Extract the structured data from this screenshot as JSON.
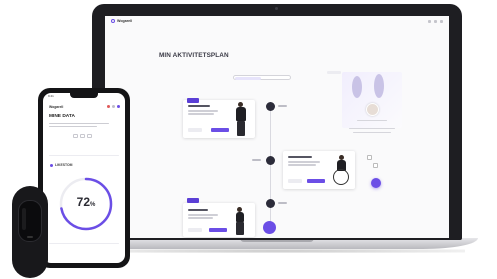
{
  "laptop": {
    "app_logo": "Wogarell",
    "screen_title": "MIN AKTIVITETSPLAN"
  },
  "phone": {
    "status_time": "9:41",
    "app_logo": "Wogarell",
    "title": "MINE DATA",
    "section_label": "LIKESTOM",
    "progress_value": 72,
    "progress_label": "72",
    "progress_unit": "%"
  },
  "colors": {
    "accent": "#6b4ee6",
    "dark": "#1e1e22",
    "ring_track": "#ececf1"
  }
}
